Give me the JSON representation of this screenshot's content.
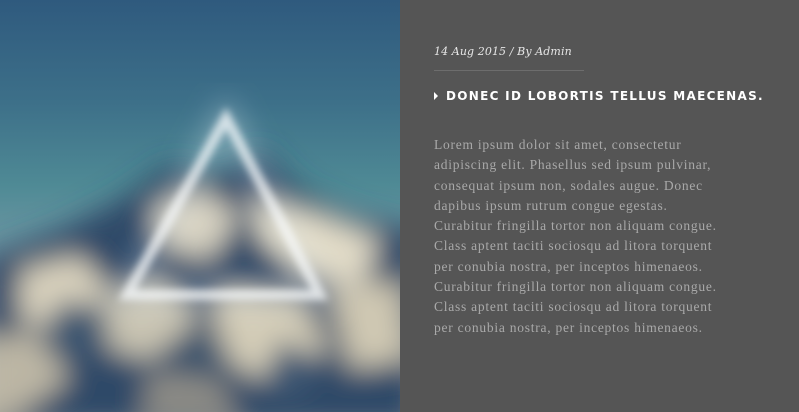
{
  "post": {
    "meta": "14 Aug 2015 / By Admin",
    "title": "DONEC ID LOBORTIS TELLUS MAECENAS.",
    "body": "Lorem ipsum dolor sit amet, consectetur\nadipiscing elit. Phasellus sed ipsum pulvinar,\nconsequat ipsum non, sodales augue. Donec\ndapibus ipsum rutrum congue egestas.\nCurabitur fringilla tortor non aliquam congue.\nClass aptent taciti sociosqu ad litora torquent\nper conubia nostra, per inceptos himenaeos.\nCurabitur fringilla tortor non aliquam congue.\nClass aptent taciti sociosqu ad litora torquent\nper conubia nostra, per inceptos himenaeos."
  },
  "colors": {
    "panel_background": "#555555",
    "title": "#ffffff",
    "body": "#a9a9a9"
  },
  "icons": {
    "title_bullet": "caret-right-icon"
  }
}
